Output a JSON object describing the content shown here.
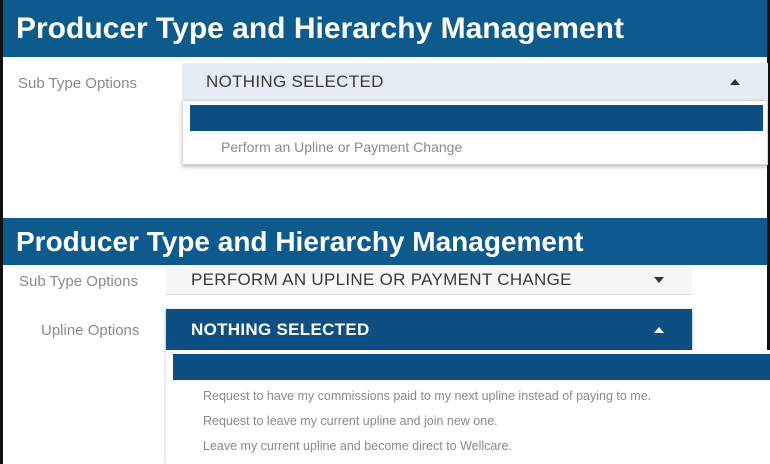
{
  "panel1": {
    "title": "Producer Type and Hierarchy Management",
    "sub_type_label": "Sub Type Options",
    "sub_type_value": "NOTHING SELECTED",
    "dropdown_options": [
      "Perform an Upline or Payment Change"
    ]
  },
  "panel2": {
    "title": "Producer Type and Hierarchy Management",
    "sub_type_label": "Sub Type Options",
    "sub_type_value": "PERFORM AN UPLINE OR PAYMENT CHANGE",
    "upline_label": "Upline Options",
    "upline_value": "NOTHING SELECTED",
    "upline_options": [
      "Request to have my commissions paid to my next upline instead of paying to me.",
      "Request to leave my current upline and join new one.",
      "Leave my current upline and become direct to Wellcare."
    ]
  },
  "colors": {
    "header_bg": "#0d5a8c",
    "selected_bg": "#0d4f82"
  },
  "icons": {
    "open_caret": "caret-up-icon",
    "closed_caret": "caret-down-icon"
  }
}
